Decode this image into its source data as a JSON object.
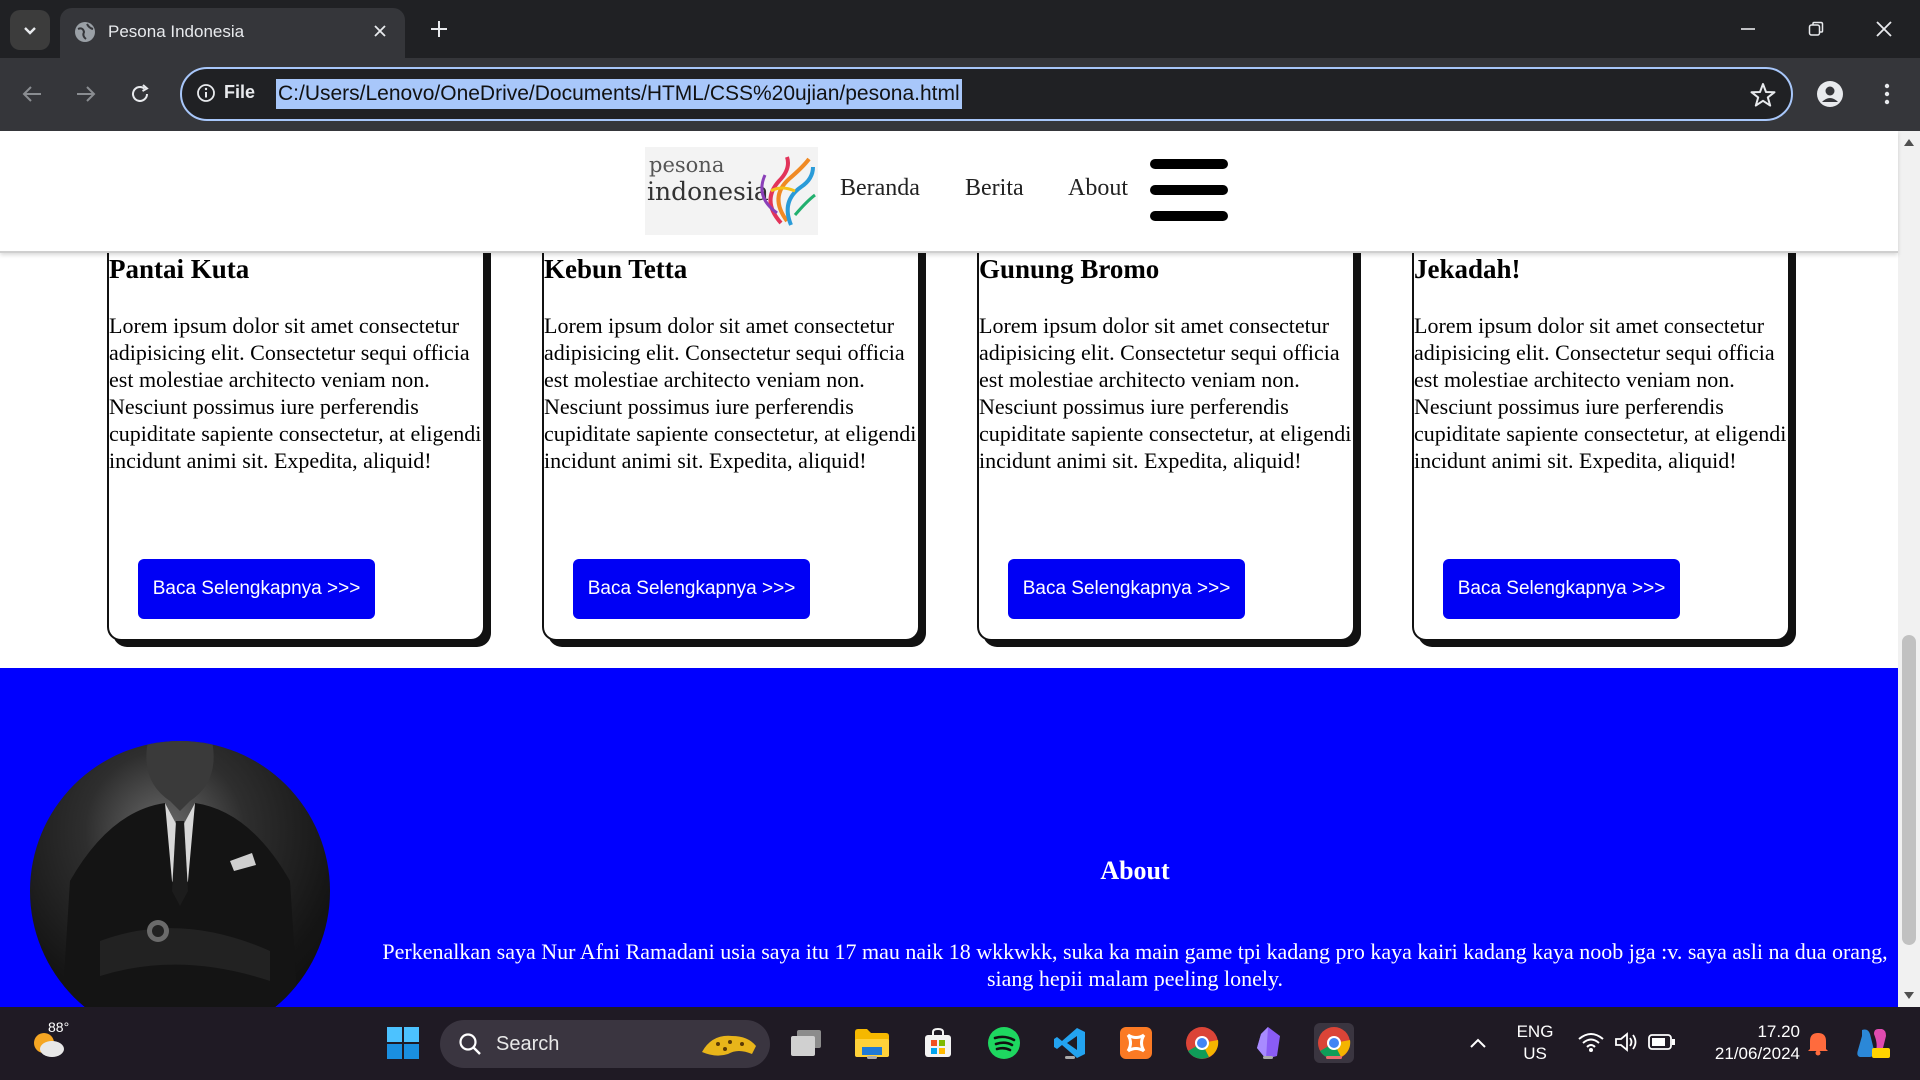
{
  "browser": {
    "tab_title": "Pesona Indonesia",
    "address_label": "File",
    "url": "C:/Users/Lenovo/OneDrive/Documents/HTML/CSS%20ujian/pesona.html"
  },
  "site": {
    "logo": {
      "line1": "pesona",
      "line2": "indonesia"
    },
    "nav": [
      "Beranda",
      "Berita",
      "About"
    ],
    "cards": [
      {
        "title": "Pantai Kuta",
        "text": "Lorem ipsum dolor sit amet consectetur adipisicing elit. Consectetur sequi officia est molestiae architecto veniam non. Nesciunt possimus iure perferendis cupiditate sapiente consectetur, at eligendi incidunt animi sit. Expedita, aliquid!",
        "button": "Baca Selengkapnya >>>"
      },
      {
        "title": "Kebun Tetta",
        "text": "Lorem ipsum dolor sit amet consectetur adipisicing elit. Consectetur sequi officia est molestiae architecto veniam non. Nesciunt possimus iure perferendis cupiditate sapiente consectetur, at eligendi incidunt animi sit. Expedita, aliquid!",
        "button": "Baca Selengkapnya >>>"
      },
      {
        "title": "Gunung Bromo",
        "text": "Lorem ipsum dolor sit amet consectetur adipisicing elit. Consectetur sequi officia est molestiae architecto veniam non. Nesciunt possimus iure perferendis cupiditate sapiente consectetur, at eligendi incidunt animi sit. Expedita, aliquid!",
        "button": "Baca Selengkapnya >>>"
      },
      {
        "title": "Jekadah!",
        "text": "Lorem ipsum dolor sit amet consectetur adipisicing elit. Consectetur sequi officia est molestiae architecto veniam non. Nesciunt possimus iure perferendis cupiditate sapiente consectetur, at eligendi incidunt animi sit. Expedita, aliquid!",
        "button": "Baca Selengkapnya >>>"
      }
    ],
    "footer": {
      "about_title": "About",
      "about_text": "Perkenalkan saya Nur Afni Ramadani usia saya itu 17 mau naik 18 wkkwkk, suka ka main game tpi kadang pro kaya kairi kadang kaya noob jga :v. saya asli na dua orang, siang hepii malam peeling lonely."
    }
  },
  "taskbar": {
    "weather_temp": "88°",
    "search_label": "Search",
    "lang_line1": "ENG",
    "lang_line2": "US",
    "time": "17.20",
    "date": "21/06/2024"
  },
  "colors": {
    "accent_blue": "#0000ff",
    "button_blue": "#0000f5",
    "chrome_dark": "#202124",
    "address_highlight": "#a8c7fa"
  },
  "icons": [
    "tab-list-icon",
    "globe-icon",
    "close-icon",
    "plus-icon",
    "minimize-icon",
    "restore-icon",
    "back-icon",
    "forward-icon",
    "reload-icon",
    "info-icon",
    "star-icon",
    "profile-icon",
    "kebab-menu-icon",
    "hamburger-menu-icon"
  ]
}
